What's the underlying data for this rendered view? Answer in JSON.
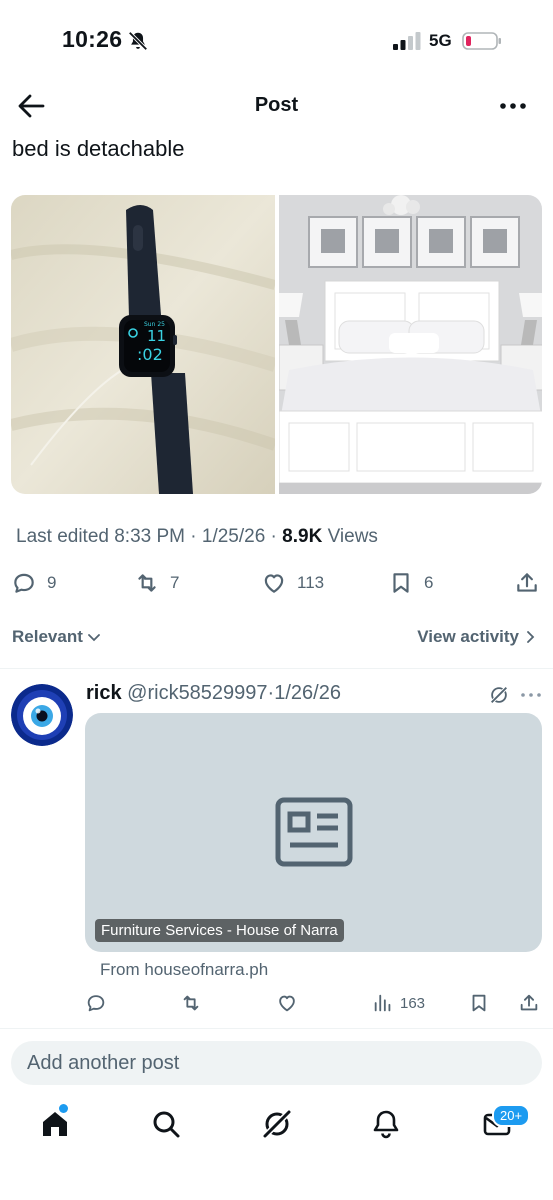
{
  "status_bar": {
    "time": "10:26",
    "network": "5G"
  },
  "header": {
    "title": "Post"
  },
  "post": {
    "text": "bed is detachable",
    "watch_date": "Sun 25",
    "watch_time_hour": "11",
    "watch_time_min": ":02",
    "meta_edited": "Last edited 8:33 PM · 1/25/26",
    "meta_sep": " · ",
    "views_count": "8.9K",
    "views_label": " Views",
    "replies": "9",
    "reposts": "7",
    "likes": "113",
    "bookmarks": "6"
  },
  "sort": {
    "relevant_label": "Relevant",
    "view_activity_label": "View activity"
  },
  "reply": {
    "name": "rick",
    "handle": "@rick58529997",
    "dot": "·",
    "date": "1/26/26",
    "card_label": "Furniture Services - House of Narra",
    "card_from": "From houseofnarra.ph",
    "views": "163"
  },
  "composer": {
    "placeholder": "Add another post"
  },
  "nav": {
    "messages_badge": "20+"
  },
  "colors": {
    "accent": "#1d9bf0",
    "secondary_text": "#536471",
    "battery_low": "#e0245e",
    "card_bg": "#cfd9de"
  },
  "icons": [
    "back-arrow-icon",
    "more-icon",
    "reply-icon",
    "repost-icon",
    "like-icon",
    "bookmark-icon",
    "share-icon",
    "chevron-down-icon",
    "chevron-right-icon",
    "grok-icon",
    "article-icon",
    "views-icon",
    "home-icon",
    "search-icon",
    "bell-icon",
    "mail-icon"
  ]
}
